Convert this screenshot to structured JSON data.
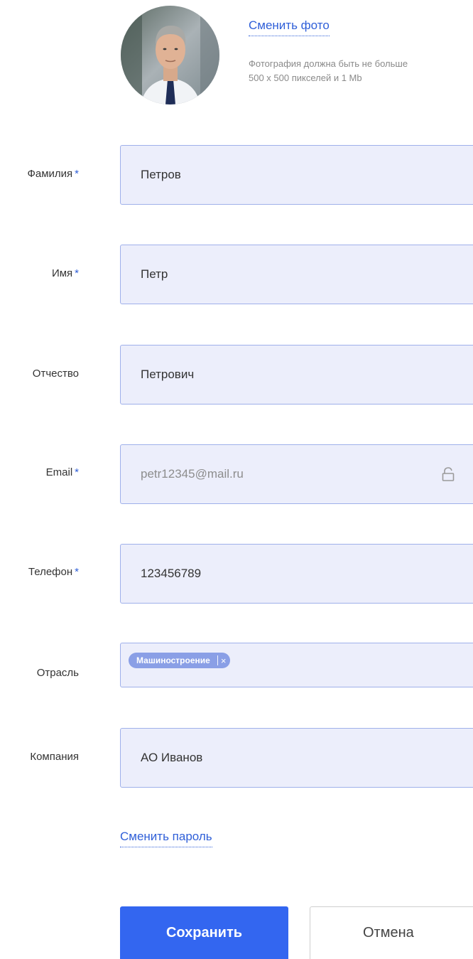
{
  "photo": {
    "change_label": "Сменить фото",
    "hint_line1": "Фотография должна быть не больше",
    "hint_line2": "500 x 500 пикселей и 1 Mb"
  },
  "form": {
    "required_mark": "*",
    "last_name": {
      "label": "Фамилия",
      "value": "Петров",
      "required": true
    },
    "first_name": {
      "label": "Имя",
      "value": "Петр",
      "required": true
    },
    "middle_name": {
      "label": "Отчество",
      "value": "Петрович",
      "required": false
    },
    "email": {
      "label": "Email",
      "value": "petr12345@mail.ru",
      "required": true,
      "locked": true
    },
    "phone": {
      "label": "Телефон",
      "value": "123456789",
      "required": true
    },
    "industry": {
      "label": "Отрасль",
      "tags": [
        "Машиностроение"
      ],
      "tag_remove": "×"
    },
    "company": {
      "label": "Компания",
      "value": "АО Иванов"
    },
    "change_password_label": "Сменить пароль"
  },
  "actions": {
    "save_label": "Сохранить",
    "cancel_label": "Отмена"
  },
  "colors": {
    "accent": "#3366f0",
    "link": "#2f5fd8",
    "field_bg": "#eceefb",
    "field_border": "#9fb0ea",
    "tag_bg": "#8a9fe6"
  }
}
